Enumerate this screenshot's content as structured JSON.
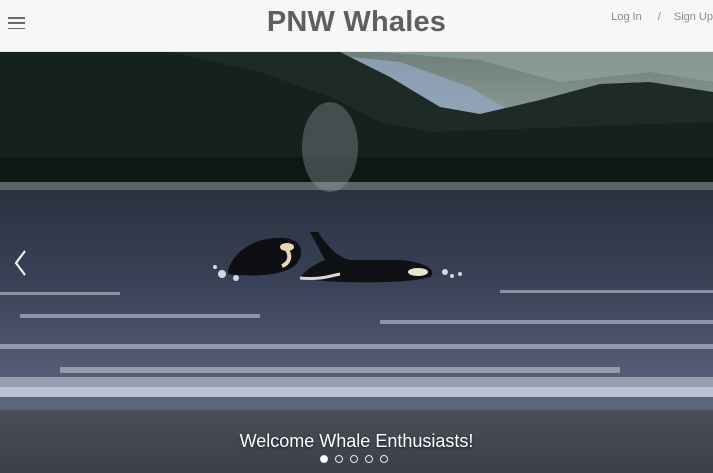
{
  "header": {
    "title": "PNW Whales",
    "login_label": "Log In",
    "separator": "/",
    "signup_label": "Sign Up"
  },
  "carousel": {
    "caption": "Welcome Whale Enthusiasts!",
    "slide_count": 5,
    "active_index": 0,
    "prev_icon": "chevron-left-icon"
  },
  "colors": {
    "header_bg": "#f7f7f7",
    "title": "#5f5f5f",
    "link": "#8a8a8a"
  }
}
